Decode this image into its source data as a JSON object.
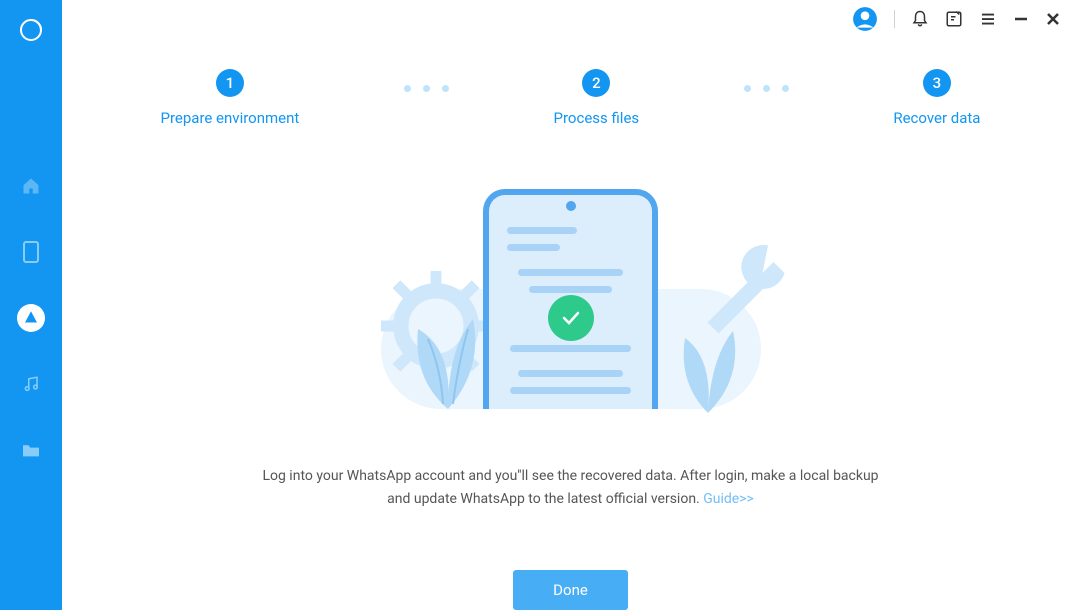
{
  "sidebar": {
    "items": [
      {
        "name": "home"
      },
      {
        "name": "phone"
      },
      {
        "name": "cloud",
        "active": true
      },
      {
        "name": "music"
      },
      {
        "name": "folder"
      }
    ]
  },
  "steps": [
    {
      "number": "1",
      "label": "Prepare environment"
    },
    {
      "number": "2",
      "label": "Process files"
    },
    {
      "number": "3",
      "label": "Recover data"
    }
  ],
  "instruction": {
    "text": "Log into your WhatsApp account and you''ll see the recovered data. After login, make a local backup and update WhatsApp to the latest official version. ",
    "guide_label": "Guide>>"
  },
  "buttons": {
    "done": "Done"
  }
}
